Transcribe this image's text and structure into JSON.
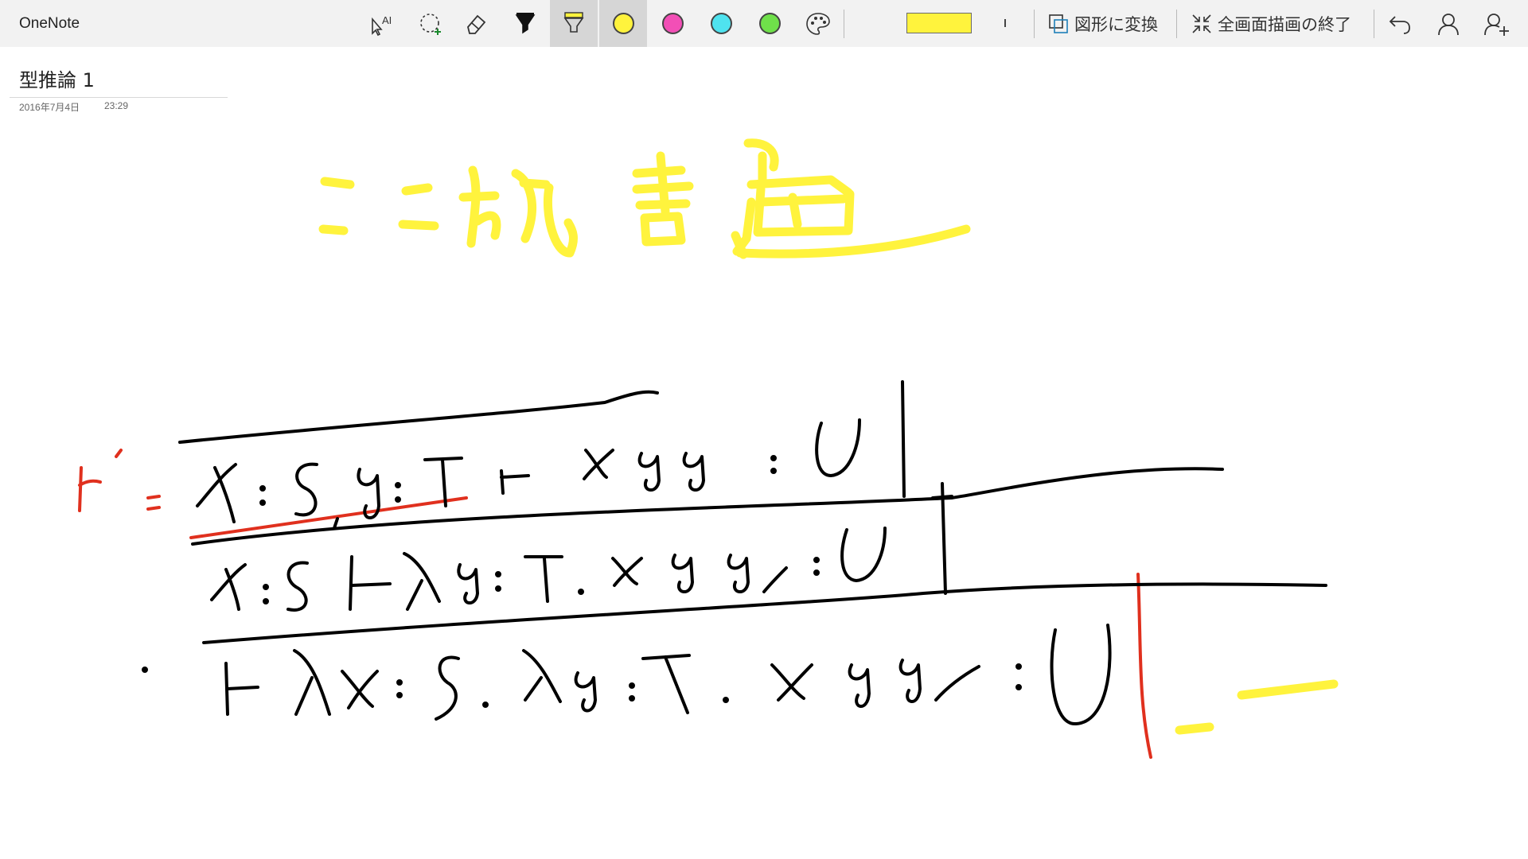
{
  "app": {
    "name": "OneNote"
  },
  "toolbar": {
    "tools": [
      {
        "name": "type-to-text-icon"
      },
      {
        "name": "lasso-select-icon"
      },
      {
        "name": "eraser-icon"
      },
      {
        "name": "pen-icon"
      },
      {
        "name": "highlighter-icon",
        "active": true
      }
    ],
    "colors": [
      "#fff33d",
      "#f24fb6",
      "#4fe3ef",
      "#6fe04a"
    ],
    "current_ink_color": "#fff33d",
    "convert_to_shapes": "図形に変換",
    "exit_fullscreen_drawing": "全画面描画の終了"
  },
  "page": {
    "title": "型推論 1",
    "date": "2016年7月4日",
    "time": "23:29"
  },
  "ink_colors": {
    "black": "#000000",
    "red": "#e0301e",
    "yellow": "#fff33d"
  }
}
